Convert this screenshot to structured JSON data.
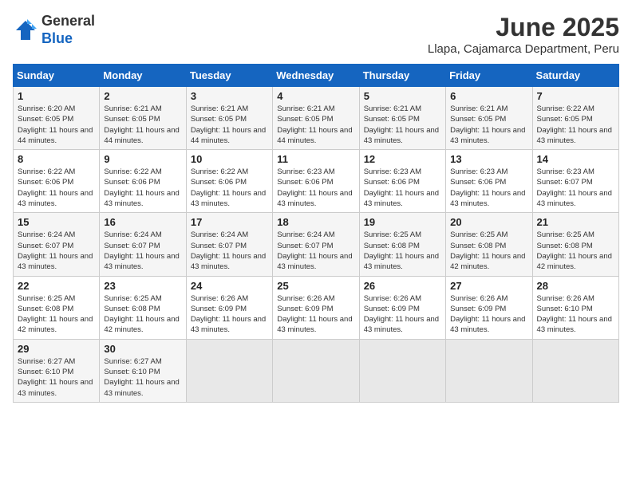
{
  "header": {
    "logo_line1": "General",
    "logo_line2": "Blue",
    "month": "June 2025",
    "location": "Llapa, Cajamarca Department, Peru"
  },
  "weekdays": [
    "Sunday",
    "Monday",
    "Tuesday",
    "Wednesday",
    "Thursday",
    "Friday",
    "Saturday"
  ],
  "weeks": [
    [
      {
        "day": "1",
        "sunrise": "6:20 AM",
        "sunset": "6:05 PM",
        "daylight": "11 hours and 44 minutes."
      },
      {
        "day": "2",
        "sunrise": "6:21 AM",
        "sunset": "6:05 PM",
        "daylight": "11 hours and 44 minutes."
      },
      {
        "day": "3",
        "sunrise": "6:21 AM",
        "sunset": "6:05 PM",
        "daylight": "11 hours and 44 minutes."
      },
      {
        "day": "4",
        "sunrise": "6:21 AM",
        "sunset": "6:05 PM",
        "daylight": "11 hours and 44 minutes."
      },
      {
        "day": "5",
        "sunrise": "6:21 AM",
        "sunset": "6:05 PM",
        "daylight": "11 hours and 43 minutes."
      },
      {
        "day": "6",
        "sunrise": "6:21 AM",
        "sunset": "6:05 PM",
        "daylight": "11 hours and 43 minutes."
      },
      {
        "day": "7",
        "sunrise": "6:22 AM",
        "sunset": "6:05 PM",
        "daylight": "11 hours and 43 minutes."
      }
    ],
    [
      {
        "day": "8",
        "sunrise": "6:22 AM",
        "sunset": "6:06 PM",
        "daylight": "11 hours and 43 minutes."
      },
      {
        "day": "9",
        "sunrise": "6:22 AM",
        "sunset": "6:06 PM",
        "daylight": "11 hours and 43 minutes."
      },
      {
        "day": "10",
        "sunrise": "6:22 AM",
        "sunset": "6:06 PM",
        "daylight": "11 hours and 43 minutes."
      },
      {
        "day": "11",
        "sunrise": "6:23 AM",
        "sunset": "6:06 PM",
        "daylight": "11 hours and 43 minutes."
      },
      {
        "day": "12",
        "sunrise": "6:23 AM",
        "sunset": "6:06 PM",
        "daylight": "11 hours and 43 minutes."
      },
      {
        "day": "13",
        "sunrise": "6:23 AM",
        "sunset": "6:06 PM",
        "daylight": "11 hours and 43 minutes."
      },
      {
        "day": "14",
        "sunrise": "6:23 AM",
        "sunset": "6:07 PM",
        "daylight": "11 hours and 43 minutes."
      }
    ],
    [
      {
        "day": "15",
        "sunrise": "6:24 AM",
        "sunset": "6:07 PM",
        "daylight": "11 hours and 43 minutes."
      },
      {
        "day": "16",
        "sunrise": "6:24 AM",
        "sunset": "6:07 PM",
        "daylight": "11 hours and 43 minutes."
      },
      {
        "day": "17",
        "sunrise": "6:24 AM",
        "sunset": "6:07 PM",
        "daylight": "11 hours and 43 minutes."
      },
      {
        "day": "18",
        "sunrise": "6:24 AM",
        "sunset": "6:07 PM",
        "daylight": "11 hours and 43 minutes."
      },
      {
        "day": "19",
        "sunrise": "6:25 AM",
        "sunset": "6:08 PM",
        "daylight": "11 hours and 43 minutes."
      },
      {
        "day": "20",
        "sunrise": "6:25 AM",
        "sunset": "6:08 PM",
        "daylight": "11 hours and 42 minutes."
      },
      {
        "day": "21",
        "sunrise": "6:25 AM",
        "sunset": "6:08 PM",
        "daylight": "11 hours and 42 minutes."
      }
    ],
    [
      {
        "day": "22",
        "sunrise": "6:25 AM",
        "sunset": "6:08 PM",
        "daylight": "11 hours and 42 minutes."
      },
      {
        "day": "23",
        "sunrise": "6:25 AM",
        "sunset": "6:08 PM",
        "daylight": "11 hours and 42 minutes."
      },
      {
        "day": "24",
        "sunrise": "6:26 AM",
        "sunset": "6:09 PM",
        "daylight": "11 hours and 43 minutes."
      },
      {
        "day": "25",
        "sunrise": "6:26 AM",
        "sunset": "6:09 PM",
        "daylight": "11 hours and 43 minutes."
      },
      {
        "day": "26",
        "sunrise": "6:26 AM",
        "sunset": "6:09 PM",
        "daylight": "11 hours and 43 minutes."
      },
      {
        "day": "27",
        "sunrise": "6:26 AM",
        "sunset": "6:09 PM",
        "daylight": "11 hours and 43 minutes."
      },
      {
        "day": "28",
        "sunrise": "6:26 AM",
        "sunset": "6:10 PM",
        "daylight": "11 hours and 43 minutes."
      }
    ],
    [
      {
        "day": "29",
        "sunrise": "6:27 AM",
        "sunset": "6:10 PM",
        "daylight": "11 hours and 43 minutes."
      },
      {
        "day": "30",
        "sunrise": "6:27 AM",
        "sunset": "6:10 PM",
        "daylight": "11 hours and 43 minutes."
      },
      null,
      null,
      null,
      null,
      null
    ]
  ]
}
